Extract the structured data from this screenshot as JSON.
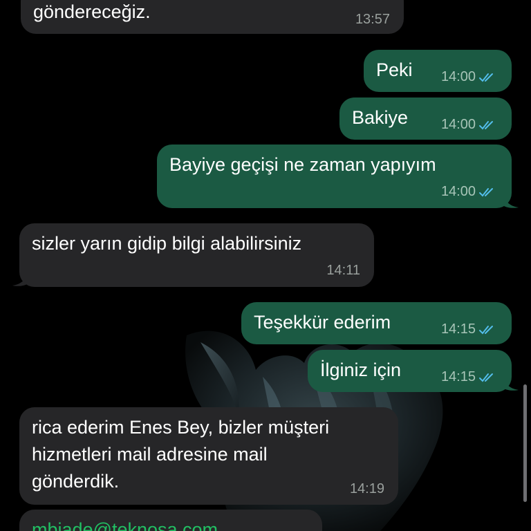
{
  "messages": [
    {
      "dir": "in",
      "text": "göndereceğiz.",
      "time": "13:57"
    },
    {
      "dir": "out",
      "text": "Peki",
      "time": "14:00"
    },
    {
      "dir": "out",
      "text": "Bakiye",
      "time": "14:00"
    },
    {
      "dir": "out",
      "text": "Bayiye geçişi ne zaman yapıyım",
      "time": "14:00"
    },
    {
      "dir": "in",
      "text": "sizler yarın gidip bilgi alabilirsiniz",
      "time": "14:11"
    },
    {
      "dir": "out",
      "text": "Teşekkür ederim",
      "time": "14:15"
    },
    {
      "dir": "out",
      "text": "İlginiz için",
      "time": "14:15"
    },
    {
      "dir": "in",
      "lines": [
        "rica ederim Enes Bey, bizler müşteri",
        "hizmetleri mail adresine mail",
        "gönderdik."
      ],
      "time": "14:19"
    },
    {
      "dir": "in",
      "text": "mbiade@teknosa.com"
    }
  ],
  "colors": {
    "background": "#000000",
    "incoming_bubble": "#262628",
    "outgoing_bubble": "#1b5a43",
    "read_tick": "#53bdeb",
    "link": "#21c063"
  },
  "icons": {
    "read_receipt": "double-check-icon"
  }
}
